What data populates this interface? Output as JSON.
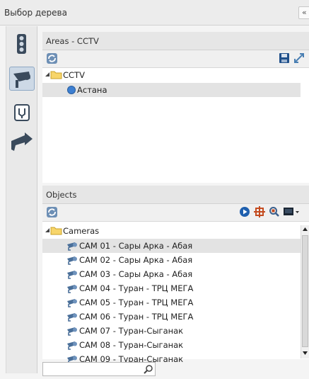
{
  "window": {
    "title": "Выбор дерева",
    "collapse_glyph": "«"
  },
  "sidebar": {
    "buttons": [
      {
        "icon": "traffic-light-icon",
        "active": false
      },
      {
        "icon": "cctv-camera-icon",
        "active": true
      },
      {
        "icon": "road-fork-icon",
        "active": false
      },
      {
        "icon": "turn-sign-icon",
        "active": false
      }
    ]
  },
  "areas": {
    "header": "Areas - CCTV",
    "tree": {
      "root": "CCTV",
      "children": [
        "Астана"
      ],
      "selected": "Астана"
    }
  },
  "objects": {
    "header": "Objects",
    "tree": {
      "root": "Cameras",
      "items": [
        "CAM 01 - Сары Арка - Абая",
        "CAM 02 - Сары Арка - Абая",
        "CAM 03 - Сары Арка - Абая",
        "CAM 04 - Туран - ТРЦ МЕГА",
        "CAM 05 - Туран - ТРЦ МЕГА",
        "CAM 06 - Туран - ТРЦ МЕГА",
        "CAM 07 - Туран-Сыганак",
        "CAM 08 - Туран-Сыганак",
        "CAM 09 - Туран-Сыганак"
      ],
      "selected": "CAM 01 - Сары Арка - Абая"
    },
    "search": {
      "value": "",
      "placeholder": ""
    }
  }
}
